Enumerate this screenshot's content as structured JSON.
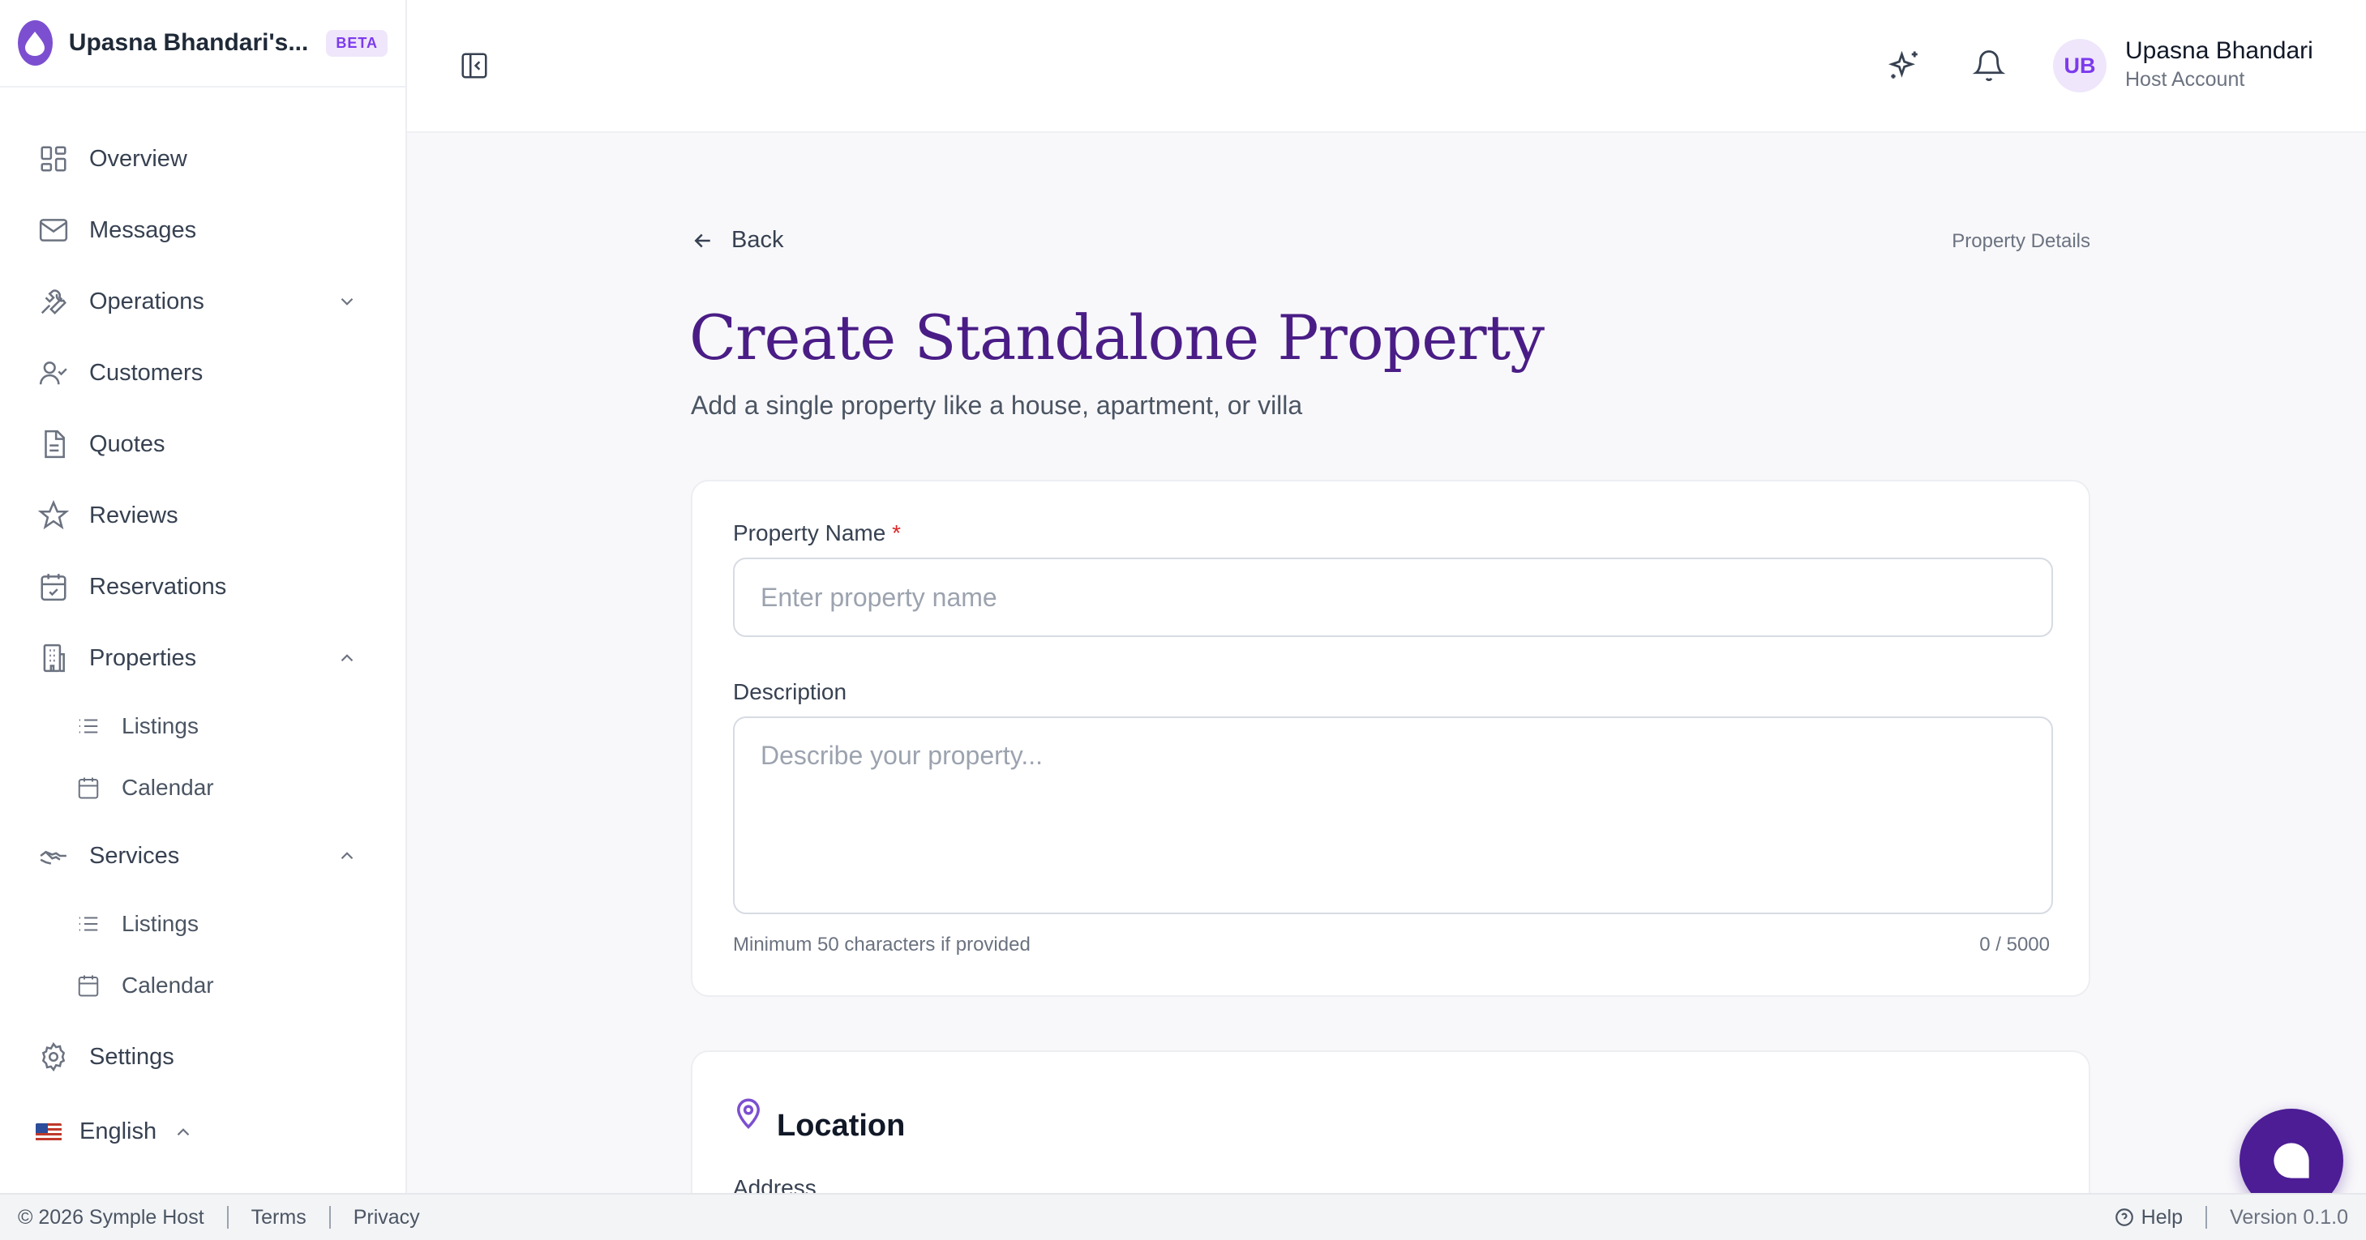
{
  "brand": {
    "name": "Upasna Bhandari's...",
    "badge": "BETA"
  },
  "sidebar": {
    "items": [
      {
        "label": "Overview",
        "icon": "grid-icon"
      },
      {
        "label": "Messages",
        "icon": "mail-icon"
      },
      {
        "label": "Operations",
        "icon": "wrench-icon",
        "chevron": "down"
      },
      {
        "label": "Customers",
        "icon": "user-check-icon"
      },
      {
        "label": "Quotes",
        "icon": "document-icon"
      },
      {
        "label": "Reviews",
        "icon": "star-icon"
      },
      {
        "label": "Reservations",
        "icon": "calendar-check-icon"
      },
      {
        "label": "Properties",
        "icon": "building-icon",
        "chevron": "up"
      },
      {
        "label": "Services",
        "icon": "handshake-icon",
        "chevron": "up"
      },
      {
        "label": "Settings",
        "icon": "gear-icon"
      }
    ],
    "properties_sub": [
      {
        "label": "Listings",
        "icon": "list-icon"
      },
      {
        "label": "Calendar",
        "icon": "calendar-icon"
      }
    ],
    "services_sub": [
      {
        "label": "Listings",
        "icon": "list-icon"
      },
      {
        "label": "Calendar",
        "icon": "calendar-icon"
      }
    ],
    "language": "English"
  },
  "header": {
    "user_initials": "UB",
    "user_name": "Upasna Bhandari",
    "user_role": "Host Account"
  },
  "main": {
    "back_label": "Back",
    "breadcrumb": "Property Details",
    "title": "Create Standalone Property",
    "subtitle": "Add a single property like a house, apartment, or villa",
    "form": {
      "name_label": "Property Name",
      "name_required": "*",
      "name_value": "",
      "name_placeholder": "Enter property name",
      "description_label": "Description",
      "description_value": "",
      "description_placeholder": "Describe your property...",
      "description_hint": "Minimum 50 characters if provided",
      "description_count": "0 / 5000"
    },
    "location": {
      "title": "Location",
      "address_label": "Address"
    }
  },
  "footer": {
    "copyright": "© 2026 Symple Host",
    "terms": "Terms",
    "privacy": "Privacy",
    "help": "Help",
    "version": "Version 0.1.0"
  },
  "colors": {
    "accent": "#7c4fd0",
    "title": "#4a1d86",
    "fab": "#4c1d95",
    "required": "#dc2626"
  }
}
